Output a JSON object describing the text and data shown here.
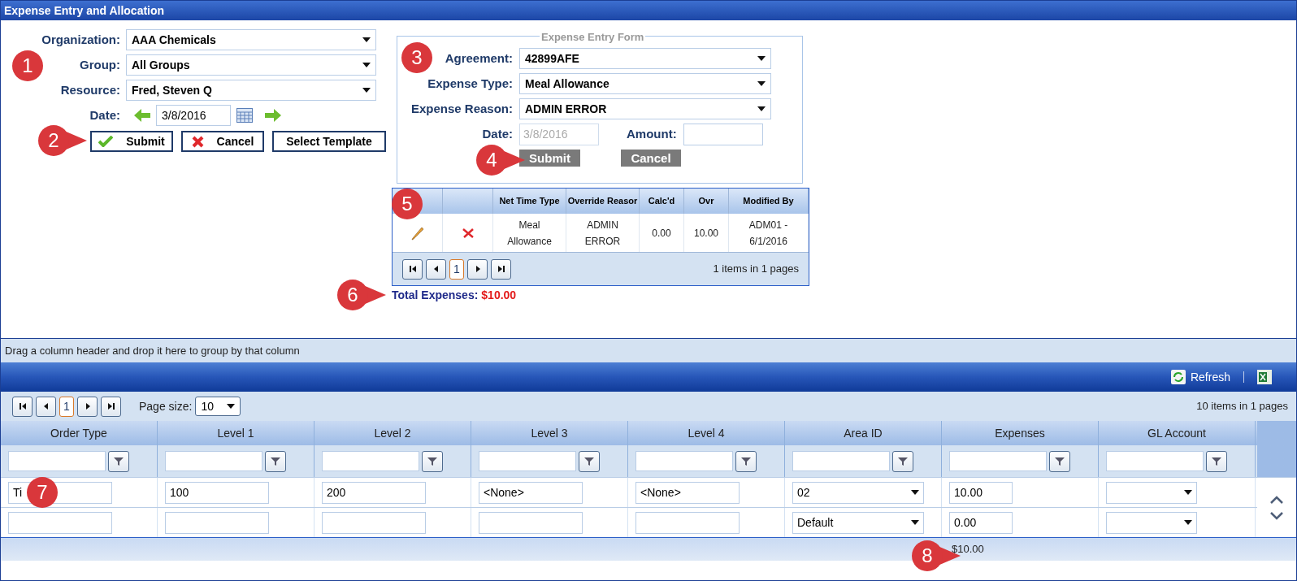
{
  "window": {
    "title": "Expense Entry and Allocation"
  },
  "filters": [
    {
      "label": "Organization:",
      "value": "AAA Chemicals"
    },
    {
      "label": "Group:",
      "value": "All Groups"
    },
    {
      "label": "Resource:",
      "value": "Fred, Steven Q"
    }
  ],
  "date": {
    "label": "Date:",
    "value": "3/8/2016"
  },
  "buttons": [
    {
      "label": "Submit",
      "kind": "submit"
    },
    {
      "label": "Cancel",
      "kind": "cancel"
    },
    {
      "label": "Select Template",
      "kind": "plain"
    }
  ],
  "form": {
    "legend": "Expense Entry Form",
    "fields": [
      {
        "label": "Agreement:",
        "value": "42899AFE"
      },
      {
        "label": "Expense Type:",
        "value": "Meal Allowance"
      },
      {
        "label": "Expense Reason:",
        "value": "ADMIN ERROR"
      }
    ],
    "date": {
      "label": "Date:",
      "value": "3/8/2016",
      "disabled": true
    },
    "amount": {
      "label": "Amount:"
    },
    "buttons": [
      "Submit",
      "Cancel"
    ]
  },
  "entries": {
    "columns": [
      "Net Time Type",
      "Override Reasor",
      "Calc'd",
      "Ovr",
      "Modified By"
    ],
    "rows": [
      {
        "cells": [
          "Meal Allowance",
          "ADMIN ERROR",
          "0.00",
          "10.00",
          "ADM01 - 6/1/2016"
        ]
      }
    ],
    "pages": [
      {
        "label": "1",
        "selected": true
      }
    ],
    "info": "1 items in 1 pages"
  },
  "total": {
    "label": "Total Expenses:",
    "value": "$10.00"
  },
  "group_hint": "Drag a column header and drop it here to group by that column",
  "toolbar": {
    "refresh": "Refresh"
  },
  "grid": {
    "pages": [
      {
        "label": "1",
        "selected": true
      }
    ],
    "page_size_label": "Page size:",
    "page_size": "10",
    "info": "10 items in 1 pages",
    "columns": [
      "Order Type",
      "Level 1",
      "Level 2",
      "Level 3",
      "Level 4",
      "Area ID",
      "Expenses",
      "GL Account"
    ],
    "rows": [
      [
        "Ti",
        "100",
        "200",
        "<None>",
        "<None>",
        "02",
        "10.00",
        ""
      ],
      [
        "",
        "",
        "",
        "",
        "",
        "Default",
        "0.00",
        ""
      ]
    ],
    "footer": "$10.00"
  },
  "markers": [
    {
      "number": "1",
      "pointer": false
    },
    {
      "number": "2",
      "pointer": true
    },
    {
      "number": "3",
      "pointer": false
    },
    {
      "number": "4",
      "pointer": true
    },
    {
      "number": "5",
      "pointer": false
    },
    {
      "number": "6",
      "pointer": true
    },
    {
      "number": "7",
      "pointer": false
    },
    {
      "number": "8",
      "pointer": true
    }
  ]
}
